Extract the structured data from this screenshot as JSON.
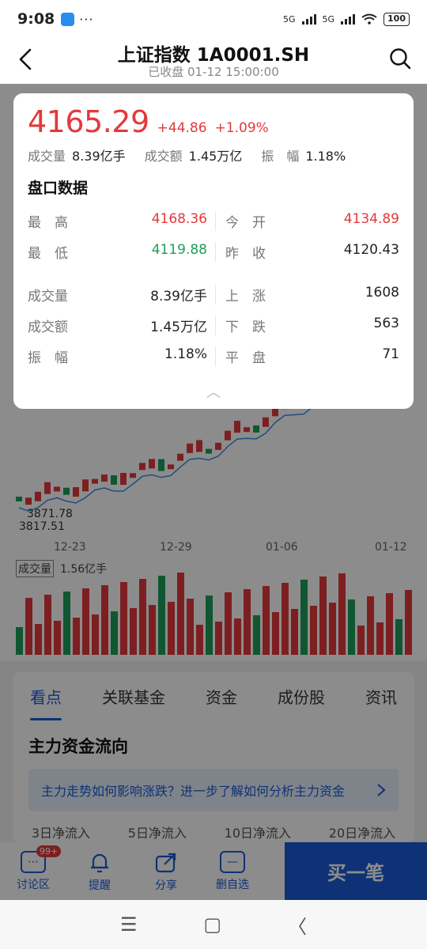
{
  "status_bar": {
    "time": "9:08",
    "signal1": "5G",
    "signal2": "5G",
    "battery": "100"
  },
  "header": {
    "title": "上证指数 1A0001.SH",
    "subtitle": "已收盘 01-12 15:00:00"
  },
  "chart_bg": {
    "low_labels": [
      "3871.78",
      "3817.51"
    ],
    "x_labels": [
      "12-23",
      "12-29",
      "01-06",
      "01-12"
    ],
    "volume_label": "成交量",
    "volume_value": "1.56亿手"
  },
  "popup": {
    "price": "4165.29",
    "change": "+44.86",
    "change_pct": "+1.09%",
    "stats": [
      {
        "label": "成交量",
        "value": "8.39亿手"
      },
      {
        "label": "成交额",
        "value": "1.45万亿"
      },
      {
        "label": "振　幅",
        "value": "1.18%"
      }
    ],
    "section_title": "盘口数据",
    "rows": [
      {
        "l_label": "最　高",
        "l_value": "4168.36",
        "l_color": "red",
        "r_label": "今　开",
        "r_value": "4134.89",
        "r_color": "red"
      },
      {
        "l_label": "最　低",
        "l_value": "4119.88",
        "l_color": "green",
        "r_label": "昨　收",
        "r_value": "4120.43",
        "r_color": ""
      },
      {
        "l_label": "成交量",
        "l_value": "8.39亿手",
        "l_color": "",
        "r_label": "上　涨",
        "r_value": "1608",
        "r_color": ""
      },
      {
        "l_label": "成交额",
        "l_value": "1.45万亿",
        "l_color": "",
        "r_label": "下　跌",
        "r_value": "563",
        "r_color": ""
      },
      {
        "l_label": "振　幅",
        "l_value": "1.18%",
        "l_color": "",
        "r_label": "平　盘",
        "r_value": "71",
        "r_color": ""
      }
    ]
  },
  "tabs": [
    "看点",
    "关联基金",
    "资金",
    "成份股",
    "资讯"
  ],
  "active_tab": 0,
  "main": {
    "section_title": "主力资金流向",
    "tip_text": "主力走势如何影响涨跌？进一步了解如何分析主力资金",
    "day_tabs": [
      "3日净流入",
      "5日净流入",
      "10日净流入",
      "20日净流入"
    ]
  },
  "bottom_bar": {
    "items": [
      {
        "label": "讨论区",
        "icon": "chat-icon",
        "badge": "99+"
      },
      {
        "label": "提醒",
        "icon": "bell-icon"
      },
      {
        "label": "分享",
        "icon": "share-icon"
      },
      {
        "label": "删自选",
        "icon": "minus-icon"
      }
    ],
    "buy_label": "买一笔"
  },
  "colors": {
    "up": "#e4393c",
    "down": "#1e9e5a",
    "accent": "#1a5bd6"
  }
}
